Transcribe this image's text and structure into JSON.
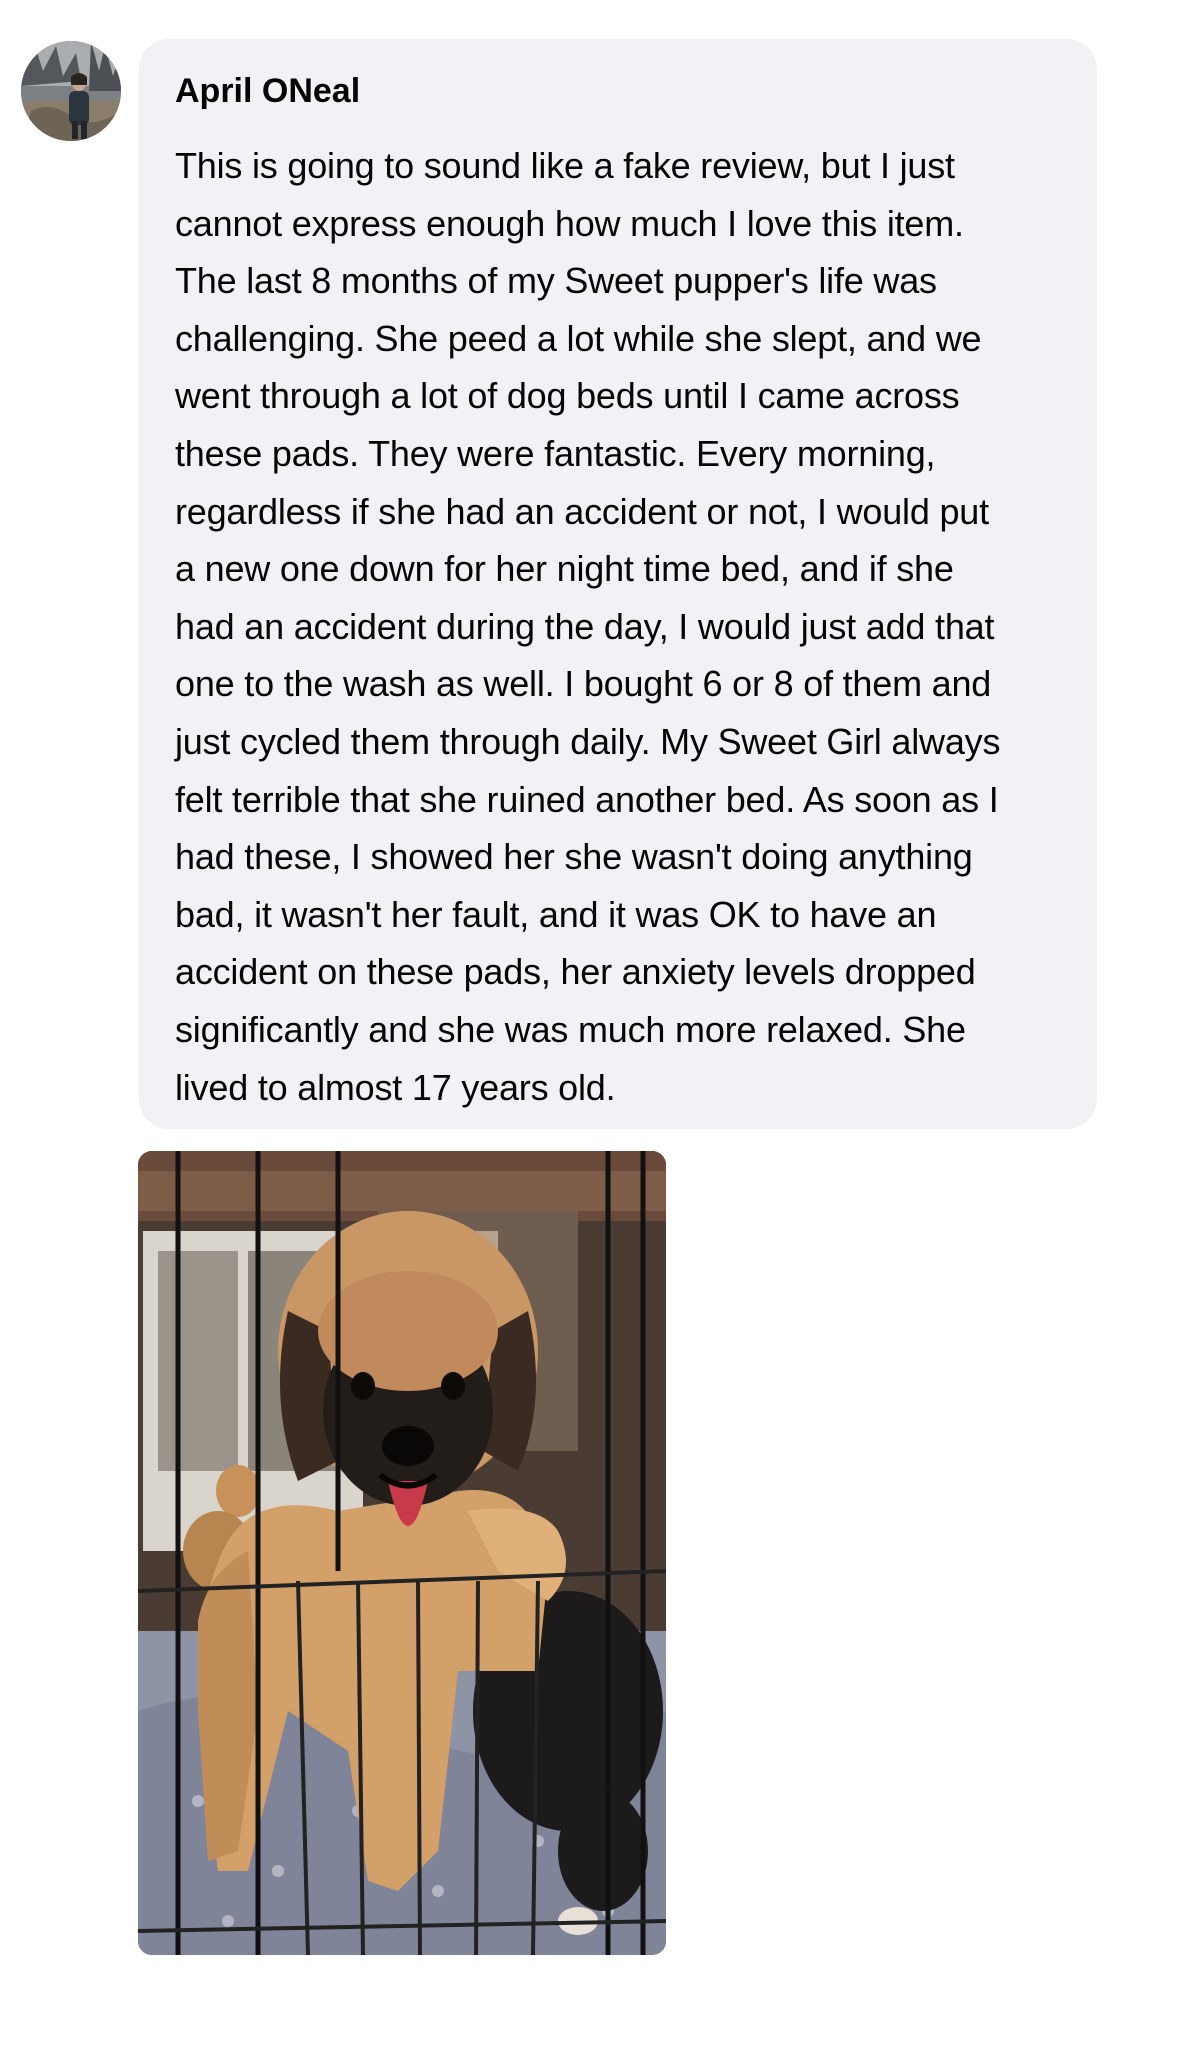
{
  "comment": {
    "author": "April ONeal",
    "avatar_icon": "user-avatar-photo",
    "text_lines": [
      "This is going to sound like a fake review, but I just",
      "cannot express enough how much I love this item.",
      "The last 8 months of my Sweet pupper's life was",
      "challenging. She peed a lot while she slept, and we",
      "went through a lot of dog beds until I came across",
      "these pads. They were fantastic. Every morning,",
      "regardless if she had an accident or not, I would put",
      "a new one down for her night time bed, and if she",
      "had an accident during the day, I would just add that",
      "one to the wash as well. I bought 6 or 8 of them and",
      "just cycled them through daily. My Sweet Girl always",
      "felt terrible that she ruined another bed. As soon as I",
      "had these, I showed her she wasn't doing anything",
      "bad, it wasn't her fault, and it was OK to have an",
      "accident on these pads, her anxiety levels dropped",
      "significantly and she was much more relaxed. She",
      "lived to almost 17 years old."
    ],
    "photo_icon": "puppy-photo"
  },
  "colors": {
    "bubble_bg": "#f0f2f5",
    "text": "#050505"
  }
}
